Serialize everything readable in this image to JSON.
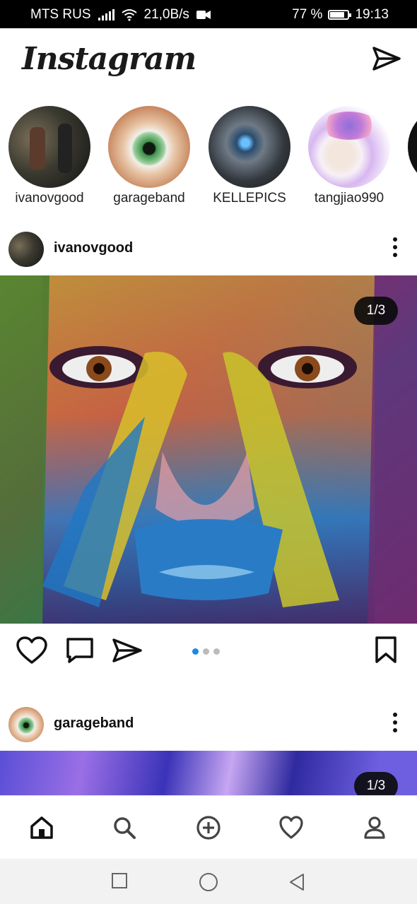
{
  "status_bar": {
    "carrier": "MTS RUS",
    "speed": "21,0B/s",
    "battery_percent": "77 %",
    "battery_level": 0.77,
    "time": "19:13"
  },
  "header": {
    "logo_text": "Instagram",
    "direct_icon": "paper-plane-icon"
  },
  "stories": [
    {
      "username": "ivanovgood"
    },
    {
      "username": "garageband"
    },
    {
      "username": "KELLEPICS"
    },
    {
      "username": "tangjiao990"
    }
  ],
  "posts": [
    {
      "username": "ivanovgood",
      "counter": "1/3",
      "carousel_index": 1,
      "carousel_total": 3
    },
    {
      "username": "garageband",
      "counter": "1/3"
    }
  ],
  "post_actions": {
    "icons": [
      "heart-icon",
      "comment-icon",
      "share-icon",
      "bookmark-icon"
    ]
  },
  "bottom_nav": {
    "items": [
      "home-icon",
      "search-icon",
      "add-icon",
      "activity-heart-icon",
      "profile-icon"
    ]
  },
  "colors": {
    "accent_blue": "#1e88e5",
    "status_bar_bg": "#000000",
    "counter_bg": "#0a0a0a"
  }
}
